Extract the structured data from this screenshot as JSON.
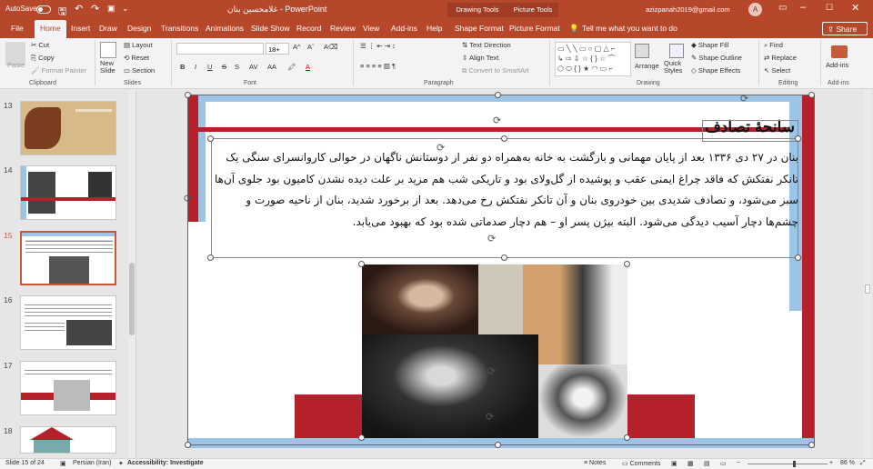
{
  "titlebar": {
    "autosave": "AutoSave",
    "doc_title": "غلامحسین بنان  -  PowerPoint",
    "drawing_tools": "Drawing Tools",
    "picture_tools": "Picture Tools",
    "account": "azizpanah2019@gmail.com",
    "avatar_letter": "A"
  },
  "tabs": [
    "File",
    "Home",
    "Insert",
    "Draw",
    "Design",
    "Transitions",
    "Animations",
    "Slide Show",
    "Record",
    "Review",
    "View",
    "Add-ins",
    "Help",
    "Shape Format",
    "Picture Format"
  ],
  "tell_me": "Tell me what you want to do",
  "share": "Share",
  "ribbon": {
    "clipboard": {
      "paste": "Paste",
      "cut": "Cut",
      "copy": "Copy",
      "format_painter": "Format Painter",
      "label": "Clipboard"
    },
    "slides": {
      "new_slide": "New Slide",
      "layout": "Layout",
      "reset": "Reset",
      "section": "Section",
      "label": "Slides"
    },
    "font": {
      "size": "18+",
      "label": "Font",
      "bold": "B",
      "italic": "I",
      "underline": "U",
      "strike": "S",
      "aa": "AA",
      "a_color": "A"
    },
    "paragraph": {
      "text_direction": "Text Direction",
      "align_text": "Align Text",
      "convert_smartart": "Convert to SmartArt",
      "label": "Paragraph"
    },
    "drawing": {
      "arrange": "Arrange",
      "quick_styles": "Quick Styles",
      "shape_fill": "Shape Fill",
      "shape_outline": "Shape Outline",
      "shape_effects": "Shape Effects",
      "label": "Drawing"
    },
    "editing": {
      "find": "Find",
      "replace": "Replace",
      "select": "Select",
      "label": "Editing"
    },
    "addins": {
      "button": "Add-ins",
      "label": "Add-ins"
    }
  },
  "thumbnails": [
    {
      "num": "13"
    },
    {
      "num": "14"
    },
    {
      "num": "15"
    },
    {
      "num": "16"
    },
    {
      "num": "17"
    },
    {
      "num": "18"
    }
  ],
  "slide": {
    "title": "سانحهٔ تصادف",
    "body": "بنان در ۲۷ دی ۱۳۳۶ بعد از پایان مهمانی و بازگشت به خانه به‌همراه دو نفر از دوستانش ناگهان در حوالی کاروانسرای سنگی یک تانکر نفتکش که فاقد چراغ ایمنی عقب و پوشیده از گل‌ولای بود و تاریکی شب هم مزید بر علت دیده نشدن کامیون بود جلوی آن‌ها سبز می‌شود، و تصادف شدیدی بین خودروی بنان و آن تانکر نفتکش رخ می‌دهد. بعد از برخورد شدید، بنان از ناحیه صورت و چشم‌ها دچار آسیب دیدگی می‌شود. البته بیژن پسر او – هم دچار صدماتی شده بود که بهبود می‌یابد."
  },
  "status": {
    "slide_of": "Slide 15 of 24",
    "language": "Persian (Iran)",
    "accessibility": "Accessibility: Investigate",
    "notes": "Notes",
    "comments": "Comments",
    "zoom": "86 %"
  },
  "colors": {
    "accent": "#b7472a",
    "slide_red": "#b5202a",
    "slide_blue": "#9dc3e6"
  }
}
